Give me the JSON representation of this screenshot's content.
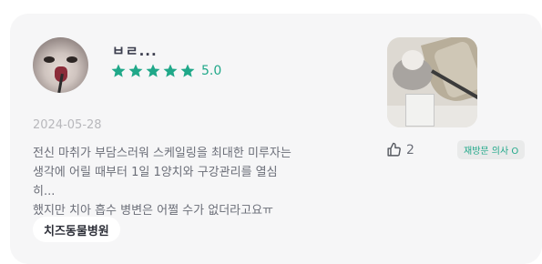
{
  "review": {
    "username": "ㅂㄹ...",
    "rating": 5,
    "score_text": "5.0",
    "date": "2024-05-28",
    "text": "전신 마취가 부담스러워 스케일링을 최대한 미루자는\n생각에 어릴 때부터 1일 1양치와 구강관리를 열심히...\n했지만 치아 흡수 병변은 어쩔 수가 없더라고요ㅠ",
    "hospital_tag": "치즈동물병원",
    "likes": "2",
    "badge": "재방문 의사 O"
  },
  "colors": {
    "accent": "#20a889",
    "card_bg": "#f6f6f7"
  },
  "icons": {
    "star": "star-icon",
    "like": "thumbs-up-icon"
  }
}
